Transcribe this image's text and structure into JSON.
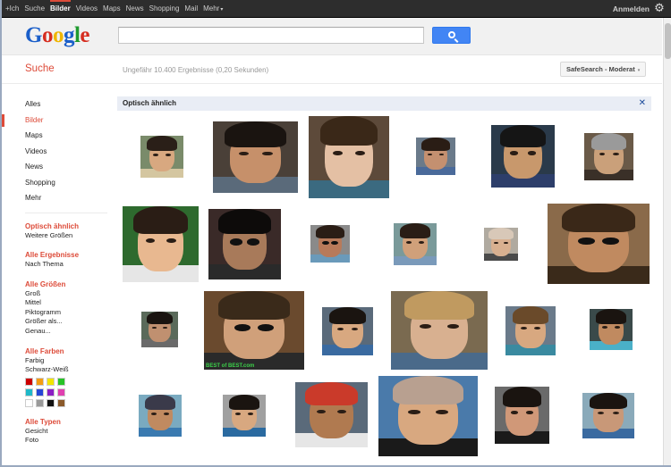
{
  "topbar": {
    "items": [
      {
        "label": "+Ich",
        "active": false
      },
      {
        "label": "Suche",
        "active": false
      },
      {
        "label": "Bilder",
        "active": true
      },
      {
        "label": "Videos",
        "active": false
      },
      {
        "label": "Maps",
        "active": false
      },
      {
        "label": "News",
        "active": false
      },
      {
        "label": "Shopping",
        "active": false
      },
      {
        "label": "Mail",
        "active": false
      },
      {
        "label": "Mehr",
        "active": false
      }
    ],
    "more_arrow": "▾",
    "signin_label": "Anmelden",
    "gear_icon": "gear-icon"
  },
  "header": {
    "logo": [
      "G",
      "o",
      "o",
      "g",
      "l",
      "e"
    ],
    "search_value": "",
    "camera_icon": "camera-icon",
    "search_button_icon": "magnifier-icon"
  },
  "subbar": {
    "title": "Suche",
    "results": "Ungefähr 10.400 Ergebnisse (0,20 Sekunden)",
    "safesearch_label": "SafeSearch - Moderat",
    "safesearch_caret": "▾"
  },
  "sidebar": {
    "nav": [
      {
        "label": "Alles",
        "active": false
      },
      {
        "label": "Bilder",
        "active": true
      },
      {
        "label": "Maps",
        "active": false
      },
      {
        "label": "Videos",
        "active": false
      },
      {
        "label": "News",
        "active": false
      },
      {
        "label": "Shopping",
        "active": false
      },
      {
        "label": "Mehr",
        "active": false
      }
    ],
    "groups": [
      {
        "head": "Optisch ähnlich",
        "options": [
          "Weitere Größen"
        ]
      },
      {
        "head": "Alle Ergebnisse",
        "options": [
          "Nach Thema"
        ]
      },
      {
        "head": "Alle Größen",
        "options": [
          "Groß",
          "Mittel",
          "Piktogramm",
          "Größer als...",
          "Genau..."
        ]
      },
      {
        "head": "Alle Farben",
        "options": [
          "Farbig",
          "Schwarz-Weiß"
        ]
      },
      {
        "head": "Alle Typen",
        "options": [
          "Gesicht",
          "Foto"
        ]
      }
    ],
    "swatch_colors": [
      "#cc0000",
      "#f39c12",
      "#f1e400",
      "#27c327",
      "#1fb8c8",
      "#2546d6",
      "#8b1fc4",
      "#e040b0",
      "#ffffff",
      "#9a9a9a",
      "#111111",
      "#8b5a2b"
    ]
  },
  "similar": {
    "title": "Optisch ähnlich",
    "close_icon": "✕",
    "watermark": "BEST of BEST.com"
  },
  "colors": {
    "accent": "#dd4b39",
    "link_blue": "#1a4a9a",
    "button_blue": "#4285f4"
  }
}
